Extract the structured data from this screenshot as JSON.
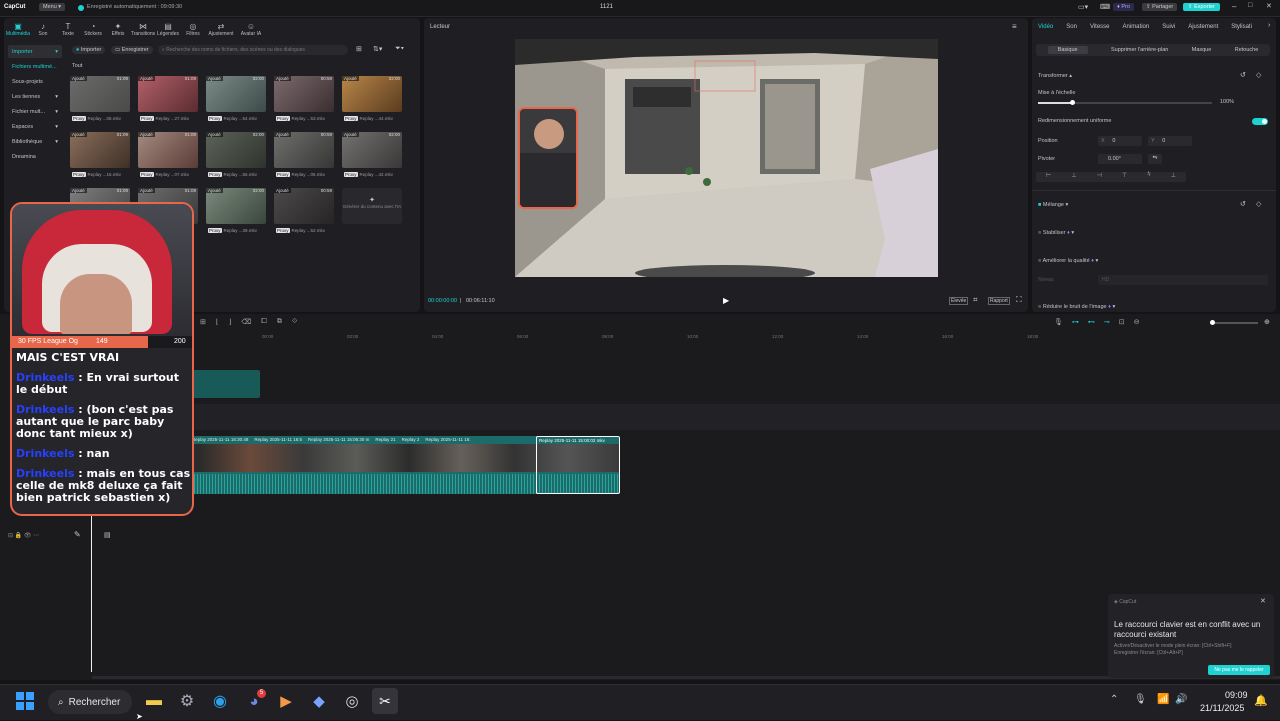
{
  "app": {
    "logo": "CapCut",
    "menu_label": "Menu",
    "autosave": "Enregistré automatiquement : 09:09:30",
    "project_title": "1121",
    "pro_label": "Pro",
    "share_label": "Partager",
    "export_label": "Exporter"
  },
  "toolbar": {
    "items": [
      {
        "label": "Multimédia",
        "icon": "media-icon"
      },
      {
        "label": "Son",
        "icon": "audio-icon"
      },
      {
        "label": "Texte",
        "icon": "text-icon"
      },
      {
        "label": "Stickers",
        "icon": "sticker-icon"
      },
      {
        "label": "Effets",
        "icon": "effects-icon"
      },
      {
        "label": "Transitions",
        "icon": "transitions-icon"
      },
      {
        "label": "Légendes",
        "icon": "captions-icon"
      },
      {
        "label": "Filtres",
        "icon": "filters-icon"
      },
      {
        "label": "Ajustement",
        "icon": "adjust-icon"
      },
      {
        "label": "Avatar IA",
        "icon": "avatar-icon"
      }
    ]
  },
  "media": {
    "sidebar": [
      "Importer",
      "Fichiers multimé...",
      "Sous-projets",
      "Les tiennes",
      "Fichier mult...",
      "Espaces",
      "Bibliothèque",
      "Dreamina"
    ],
    "import_btn": "Importer",
    "record_btn": "Enregistrer",
    "search_placeholder": "Recherche des noms de fichiers, des scènes ou des dialogues",
    "filter_all": "Tout",
    "added_tag": "Ajouté",
    "proxy_tag": "Proxy",
    "clips": [
      {
        "dur": "01:09",
        "name": "Replay ...05.mkv"
      },
      {
        "dur": "01:09",
        "name": "Replay ...27.mkv"
      },
      {
        "dur": "02:00",
        "name": "Replay ...54.mkv"
      },
      {
        "dur": "00:59",
        "name": "Replay ...53.mkv"
      },
      {
        "dur": "02:00",
        "name": "Replay ...44.mkv"
      },
      {
        "dur": "01:09",
        "name": "Replay ...16.mkv"
      },
      {
        "dur": "01:09",
        "name": "Replay ...07.mkv"
      },
      {
        "dur": "02:00",
        "name": "Replay ...56.mkv"
      },
      {
        "dur": "00:59",
        "name": "Replay ...06.mkv"
      },
      {
        "dur": "02:00",
        "name": "Replay ...42.mkv"
      },
      {
        "dur": "01:09",
        "name": ""
      },
      {
        "dur": "01:09",
        "name": ""
      },
      {
        "dur": "02:00",
        "name": "Replay ...39.mkv"
      },
      {
        "dur": "00:59",
        "name": "Replay ...52.mkv"
      }
    ],
    "ai_gen": "Générer du contenu avec l'IA"
  },
  "player": {
    "title": "Lecteur",
    "current": "00:00:00:00",
    "total": "00:06:11:10",
    "quality": "Élevée",
    "ratio": "Rapport"
  },
  "props": {
    "tabs": [
      "Vidéo",
      "Son",
      "Vitesse",
      "Animation",
      "Suivi",
      "Ajustement",
      "Stylisati"
    ],
    "subtabs": [
      "Basique",
      "Supprimer l'arrière-plan",
      "Masque",
      "Retouche"
    ],
    "transform": "Transformer",
    "scale_label": "Mise à l'échelle",
    "scale_value": "100%",
    "uniform": "Redimensionnement uniforme",
    "position_label": "Position",
    "pos_x_label": "X",
    "pos_x": "0",
    "pos_y_label": "Y",
    "pos_y": "0",
    "rotate_label": "Pivoter",
    "rotate_value": "0.00°",
    "blend": "Mélange",
    "stabilize": "Stabiliser",
    "enhance": "Améliorer la qualité",
    "enhance_mode": "Niveau",
    "enhance_mode_value": "HD",
    "denoise": "Réduire le bruit de l'image"
  },
  "timeline": {
    "ticks": [
      "00:00",
      "02:00",
      "04:00",
      "06:00",
      "08:00",
      "10:00",
      "12:00",
      "14:00",
      "16:00",
      "18:00"
    ],
    "clips": [
      "Replay 2025-11-11",
      "Replay 2025-11-11",
      "Replay 20",
      "Replay 2025-11-11 16:30:48",
      "Replay 2025-11-11 16:5",
      "Replay 2025-",
      "Replay 2025-11-11 15:06:30 m",
      "Replay 21",
      "Replay 2",
      "Replay 2025-11-11 16:",
      "Replay 2025-11-11 15:00:02 mkv"
    ]
  },
  "overlay": {
    "game": "30 FPS League Og",
    "num1": "149",
    "num2": "200",
    "header": "MAIS C'EST VRAI",
    "messages": [
      {
        "user": "Drinkeels",
        "text": "En vrai surtout le début"
      },
      {
        "user": "Drinkeels",
        "text": "(bon c'est pas autant que le parc baby donc tant mieux x)"
      },
      {
        "user": "Drinkeels",
        "text": "nan"
      },
      {
        "user": "Drinkeels",
        "text": "mais en tous cas celle de mk8 deluxe ça fait bien patrick sebastien x)"
      }
    ]
  },
  "toast": {
    "app": "CapCut",
    "title": "Le raccourci clavier est en conflit avec un raccourci existant",
    "line1": "Activer/Désactiver le mode plein écran: [Ctrl+Shift+F]",
    "line2": "Enregistrer l'écran: [Ctrl+Alt+P]",
    "button": "Ne pas me le rappeler"
  },
  "taskbar": {
    "search": "Rechercher",
    "time": "09:09",
    "date": "21/11/2025",
    "badge": "5"
  },
  "colors": {
    "accent": "#1ed2d2",
    "brand_chat": "#e8664a",
    "clip": "#1a6b69"
  }
}
